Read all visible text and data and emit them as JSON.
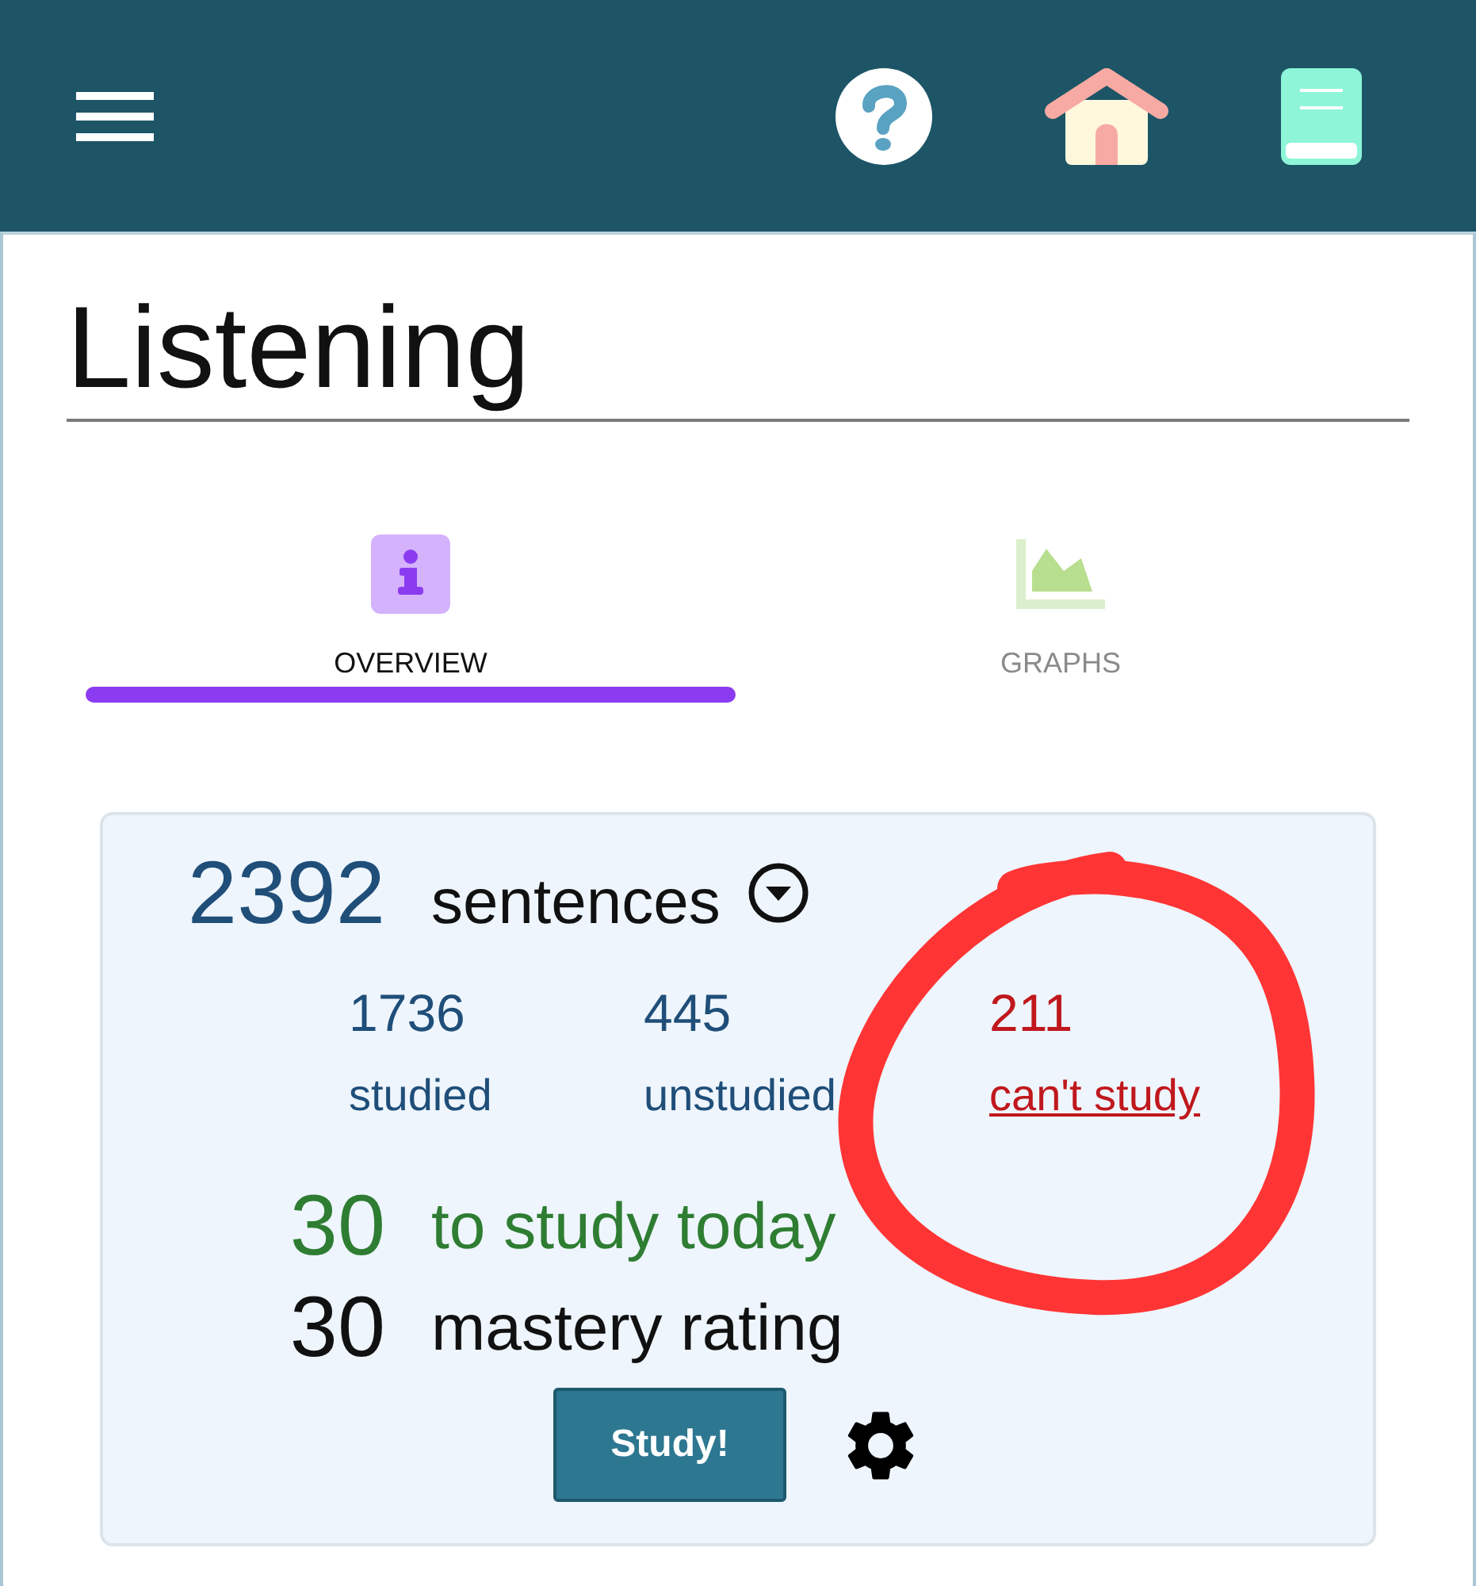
{
  "header": {
    "icons": [
      {
        "kind": "menu"
      },
      {
        "kind": "help"
      },
      {
        "kind": "home"
      },
      {
        "kind": "book"
      }
    ]
  },
  "page": {
    "title": "Listening"
  },
  "tabs": [
    {
      "label": "OVERVIEW",
      "kind": "info",
      "selected": true
    },
    {
      "label": "GRAPHS",
      "kind": "graph",
      "selected": false
    }
  ],
  "summary": {
    "total": {
      "value": "2392",
      "label": "sentences"
    },
    "stats": [
      {
        "value": "1736",
        "label": "studied",
        "kind": "plain"
      },
      {
        "value": "445",
        "label": "unstudied",
        "kind": "plain"
      },
      {
        "value": "211",
        "label": "can't study",
        "kind": "link"
      }
    ],
    "due_today": {
      "count": "30",
      "label": "to study today"
    },
    "mastery": {
      "rating": "30",
      "label": "mastery rating"
    },
    "study_button": "Study!"
  },
  "annotation": {
    "kind": "circle"
  }
}
